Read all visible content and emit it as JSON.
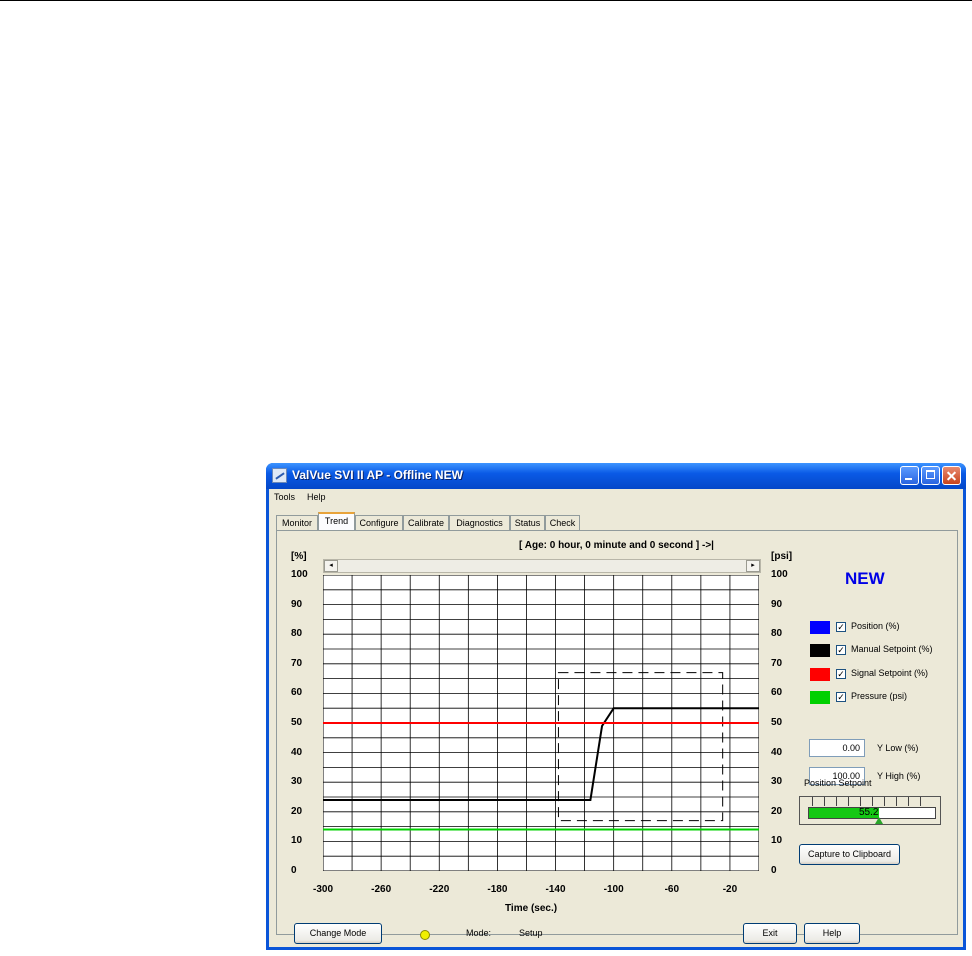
{
  "window": {
    "title": "ValVue SVI II AP - Offline  NEW"
  },
  "menu": [
    "Tools",
    "Help"
  ],
  "tabs": [
    "Monitor",
    "Trend",
    "Configure",
    "Calibrate",
    "Diagnostics",
    "Status",
    "Check"
  ],
  "active_tab": "Trend",
  "trend": {
    "age_text": "[ Age:  0 hour, 0 minute and 0 second ] ->|",
    "left_unit": "[%]",
    "right_unit": "[psi]",
    "x_axis_label": "Time (sec.)",
    "x_ticks": [
      "-300",
      "-260",
      "-220",
      "-180",
      "-140",
      "-100",
      "-60",
      "-20"
    ],
    "y_ticks_left": [
      "100",
      "90",
      "80",
      "70",
      "60",
      "50",
      "40",
      "30",
      "20",
      "10",
      "0"
    ],
    "y_ticks_right": [
      "100",
      "90",
      "80",
      "70",
      "60",
      "50",
      "40",
      "30",
      "20",
      "10",
      "0"
    ],
    "scroll_left": "◂",
    "scroll_right": "▸"
  },
  "chart_data": {
    "type": "line",
    "xlabel": "Time (sec.)",
    "ylabel": "[%]",
    "y2label": "[psi]",
    "xlim": [
      -300,
      0
    ],
    "ylim": [
      0,
      100
    ],
    "grid": true,
    "series": [
      {
        "name": "Manual Setpoint (%)",
        "color": "#000000",
        "points": [
          [
            -300,
            24
          ],
          [
            -116,
            24
          ],
          [
            -108,
            49
          ],
          [
            -100,
            55
          ],
          [
            0,
            55
          ]
        ]
      },
      {
        "name": "Signal Setpoint (%)",
        "color": "#ff0000",
        "points": [
          [
            -300,
            50
          ],
          [
            0,
            50
          ]
        ]
      },
      {
        "name": "Pressure (psi)",
        "color": "#00d000",
        "points": [
          [
            -300,
            14
          ],
          [
            0,
            14
          ]
        ]
      }
    ],
    "zoom_box": {
      "x": [
        -138,
        -25
      ],
      "y": [
        17,
        67
      ]
    }
  },
  "mode_label": "NEW",
  "legend": [
    {
      "label": "Position (%)",
      "color": "#0000ff",
      "checked": true
    },
    {
      "label": "Manual Setpoint (%)",
      "color": "#000000",
      "checked": true
    },
    {
      "label": "Signal Setpoint (%)",
      "color": "#ff0000",
      "checked": true
    },
    {
      "label": "Pressure (psi)",
      "color": "#00d000",
      "checked": true
    }
  ],
  "y_low": {
    "value": "0.00",
    "label": "Y Low (%)"
  },
  "y_high": {
    "value": "100.00",
    "label": "Y High (%)"
  },
  "position_setpoint": {
    "label": "Position Setpoint",
    "value": "55.2",
    "fraction": 0.552
  },
  "buttons": {
    "capture": "Capture to Clipboard",
    "change_mode": "Change Mode",
    "exit": "Exit",
    "help": "Help"
  },
  "status": {
    "mode_label": "Mode:",
    "mode_value": "Setup"
  }
}
